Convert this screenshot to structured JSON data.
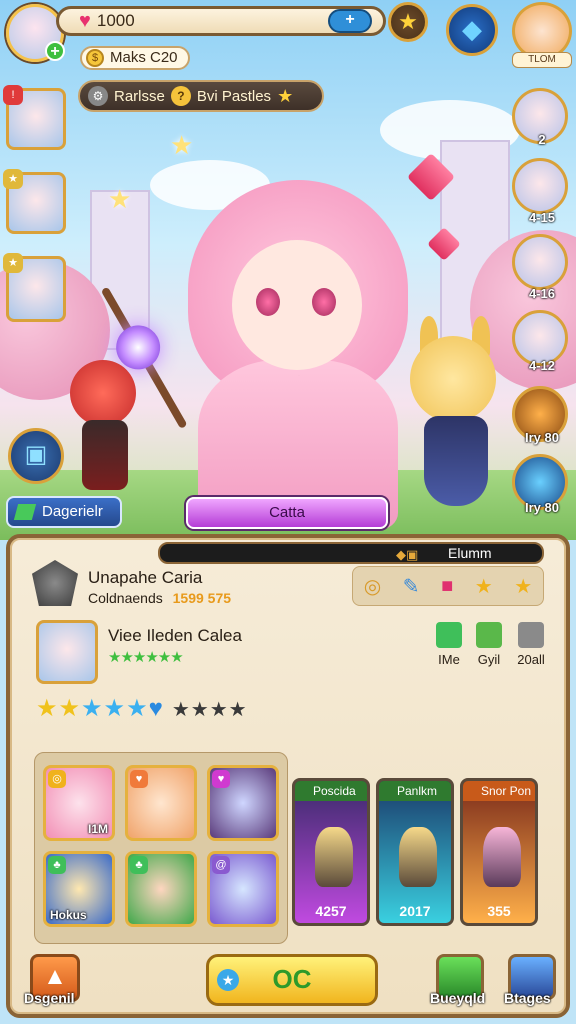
{
  "top": {
    "hearts": "1000",
    "maks": "Maks C20",
    "right_avatar_label": "TLOM"
  },
  "event": {
    "left_text": "Rarlsse",
    "right_text": "Bvi Pastles"
  },
  "left_side": {
    "dager_label": "Dagerielr"
  },
  "right_column": [
    {
      "label": "2"
    },
    {
      "label": "4-15"
    },
    {
      "label": "4-16"
    },
    {
      "label": "4-12"
    },
    {
      "label": "Iry 80"
    },
    {
      "label": "Iry 80"
    }
  ],
  "main_button": "Catta",
  "panel": {
    "top_label": "Elumm",
    "unit_name": "Unapahe Caria",
    "unit_sub": "Coldnaends",
    "unit_value": "1599 575",
    "hero_name": "Viee Ileden Calea",
    "hero_stars": "★★★★★★",
    "stats": [
      {
        "label": "IMe"
      },
      {
        "label": "Gyil"
      },
      {
        "label": "20all"
      }
    ],
    "rating_filled": "★★",
    "rating_blue": "★★★",
    "rating_heart": "♥",
    "rating_empty": "★★★★"
  },
  "cards": [
    {
      "label": "I1M"
    },
    {
      "label": ""
    },
    {
      "label": ""
    },
    {
      "label": "Hokus"
    },
    {
      "label": ""
    },
    {
      "label": ""
    }
  ],
  "summon_cards": [
    {
      "title": "Poscida",
      "value": "4257"
    },
    {
      "title": "Panlkm",
      "value": "2017"
    },
    {
      "title": "Snor Pon",
      "value": "355"
    }
  ],
  "bottom": {
    "left_label": "Dsgenil",
    "ok_label": "OC",
    "right1_label": "Bueyqld",
    "right2_label": "Btages"
  }
}
